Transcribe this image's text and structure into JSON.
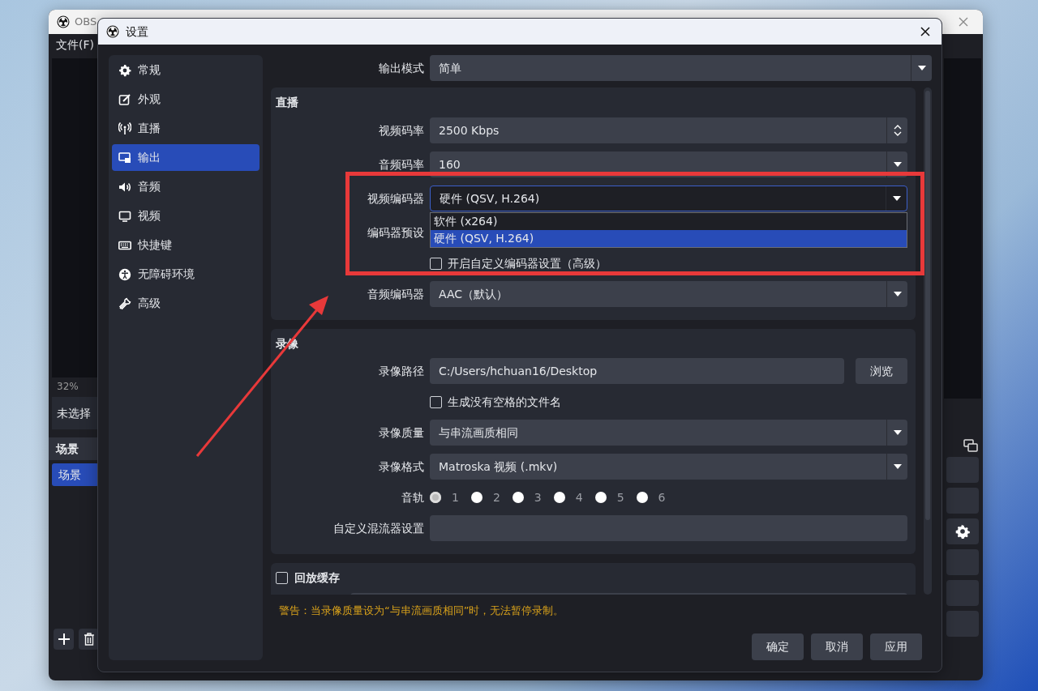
{
  "background_window": {
    "title": "OBS",
    "menu": [
      "文件(F)"
    ],
    "zoom": "32%",
    "source_info": "未选择",
    "scenes": {
      "title": "场景",
      "items": [
        {
          "label": "场景",
          "selected": true
        }
      ]
    }
  },
  "dialog": {
    "title": "设置",
    "sidebar": [
      {
        "label": "常规",
        "selected": false
      },
      {
        "label": "外观",
        "selected": false
      },
      {
        "label": "直播",
        "selected": false
      },
      {
        "label": "输出",
        "selected": true
      },
      {
        "label": "音频",
        "selected": false
      },
      {
        "label": "视频",
        "selected": false
      },
      {
        "label": "快捷键",
        "selected": false
      },
      {
        "label": "无障碍环境",
        "selected": false
      },
      {
        "label": "高级",
        "selected": false
      }
    ],
    "output_mode": {
      "label": "输出模式",
      "value": "简单"
    },
    "streaming": {
      "title": "直播",
      "fields": [
        {
          "kind": "spin",
          "label": "视频码率",
          "value": "2500 Kbps"
        },
        {
          "kind": "select",
          "label": "音频码率",
          "value": "160"
        },
        {
          "kind": "select",
          "label": "视频编码器",
          "value": "硬件 (QSV, H.264)",
          "expanded": true,
          "options": [
            {
              "label": "软件 (x264)",
              "selected": false
            },
            {
              "label": "硬件 (QSV, H.264)",
              "selected": true
            }
          ]
        },
        {
          "kind": "covered",
          "label": "编码器预设"
        },
        {
          "kind": "checkbox",
          "label": "开启自定义编码器设置（高级）",
          "checked": false
        },
        {
          "kind": "select",
          "label": "音频编码器",
          "value": "AAC（默认）"
        }
      ]
    },
    "recording": {
      "title": "录像",
      "fields": [
        {
          "kind": "path",
          "label": "录像路径",
          "value": "C:/Users/hchuan16/Desktop",
          "button": "浏览"
        },
        {
          "kind": "checkbox",
          "label": "生成没有空格的文件名",
          "checked": false
        },
        {
          "kind": "select",
          "label": "录像质量",
          "value": "与串流画质相同"
        },
        {
          "kind": "select",
          "label": "录像格式",
          "value": "Matroska 视频 (.mkv)"
        },
        {
          "kind": "radios",
          "label": "音轨",
          "options": [
            {
              "label": "1",
              "selected": true
            },
            {
              "label": "2",
              "selected": false
            },
            {
              "label": "3",
              "selected": false
            },
            {
              "label": "4",
              "selected": false
            },
            {
              "label": "5",
              "selected": false
            },
            {
              "label": "6",
              "selected": false
            }
          ]
        },
        {
          "kind": "text",
          "label": "自定义混流器设置"
        }
      ]
    },
    "replay_buffer": {
      "title": "回放缓存",
      "checked": false
    },
    "warning": "警告：当录像质量设为“与串流画质相同”时，无法暂停录制。",
    "buttons": [
      "确定",
      "取消",
      "应用"
    ]
  }
}
